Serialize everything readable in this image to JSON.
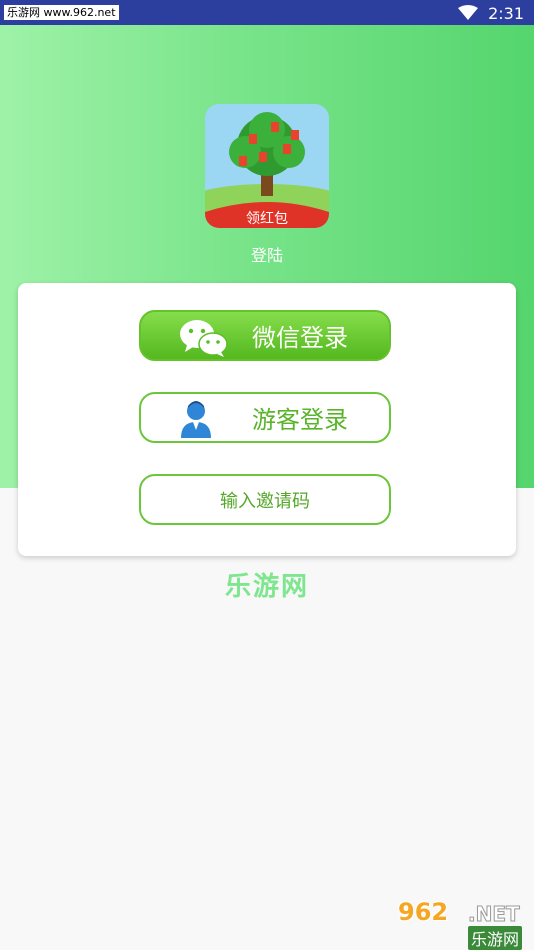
{
  "status_bar": {
    "left_text": "乐游网 www.962.net",
    "time": "2:31"
  },
  "logo": {
    "badge_text": "领红包"
  },
  "header": {
    "title": "登陆"
  },
  "buttons": {
    "wechat_label": "微信登录",
    "guest_label": "游客登录",
    "invite_label": "输入邀请码"
  },
  "watermark": {
    "center_text": "乐游网",
    "corner_number": "962",
    "corner_suffix": ".NET",
    "corner_text": "乐游网"
  },
  "colors": {
    "status_bar": "#2c3e9e",
    "header_green": "#79e48a",
    "button_green": "#5cbd28"
  }
}
